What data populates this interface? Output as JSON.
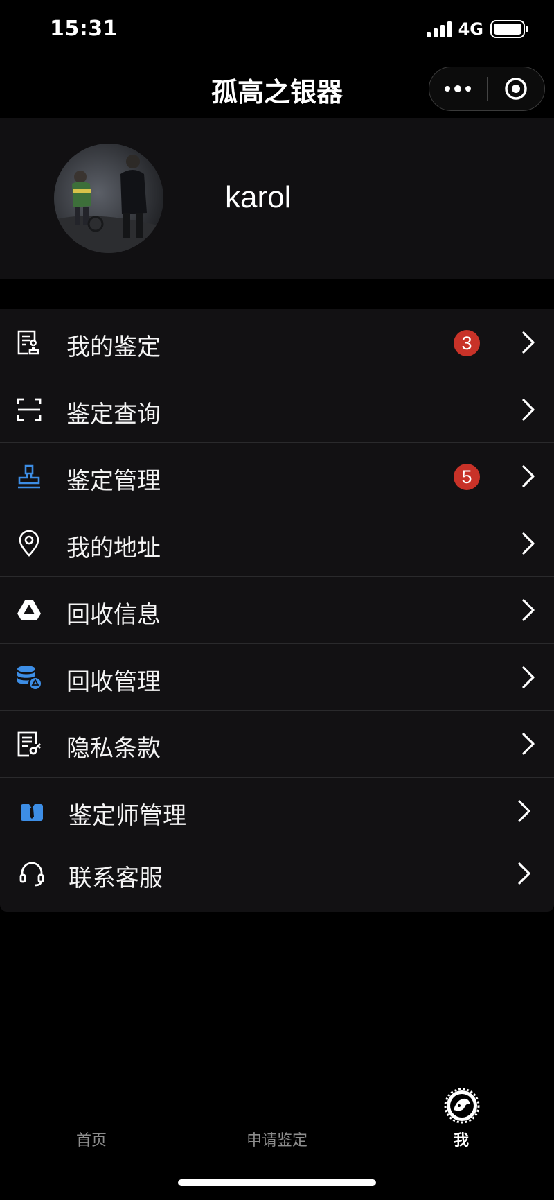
{
  "status_bar": {
    "time": "15:31",
    "network": "4G"
  },
  "nav": {
    "title": "孤高之银器"
  },
  "profile": {
    "username": "karol"
  },
  "menu": [
    {
      "label": "我的鉴定",
      "icon": "document-stamp-icon",
      "badge": "3"
    },
    {
      "label": "鉴定查询",
      "icon": "scan-frame-icon",
      "badge": ""
    },
    {
      "label": "鉴定管理",
      "icon": "stamp-icon",
      "badge": "5"
    },
    {
      "label": "我的地址",
      "icon": "location-pin-icon",
      "badge": ""
    },
    {
      "label": "回收信息",
      "icon": "recycle-triangle-icon",
      "badge": ""
    },
    {
      "label": "回收管理",
      "icon": "database-recycle-icon",
      "badge": ""
    },
    {
      "label": "隐私条款",
      "icon": "document-key-icon",
      "badge": ""
    },
    {
      "label": "鉴定师管理",
      "icon": "appraiser-icon",
      "badge": ""
    },
    {
      "label": "联系客服",
      "icon": "headset-icon",
      "badge": ""
    }
  ],
  "tabs": [
    {
      "label": "首页"
    },
    {
      "label": "申请鉴定"
    },
    {
      "label": "我",
      "active": true
    }
  ],
  "colors": {
    "background": "#000000",
    "panel": "#121113",
    "accent_blue": "#3d8ee6",
    "badge_red": "#c83228"
  }
}
